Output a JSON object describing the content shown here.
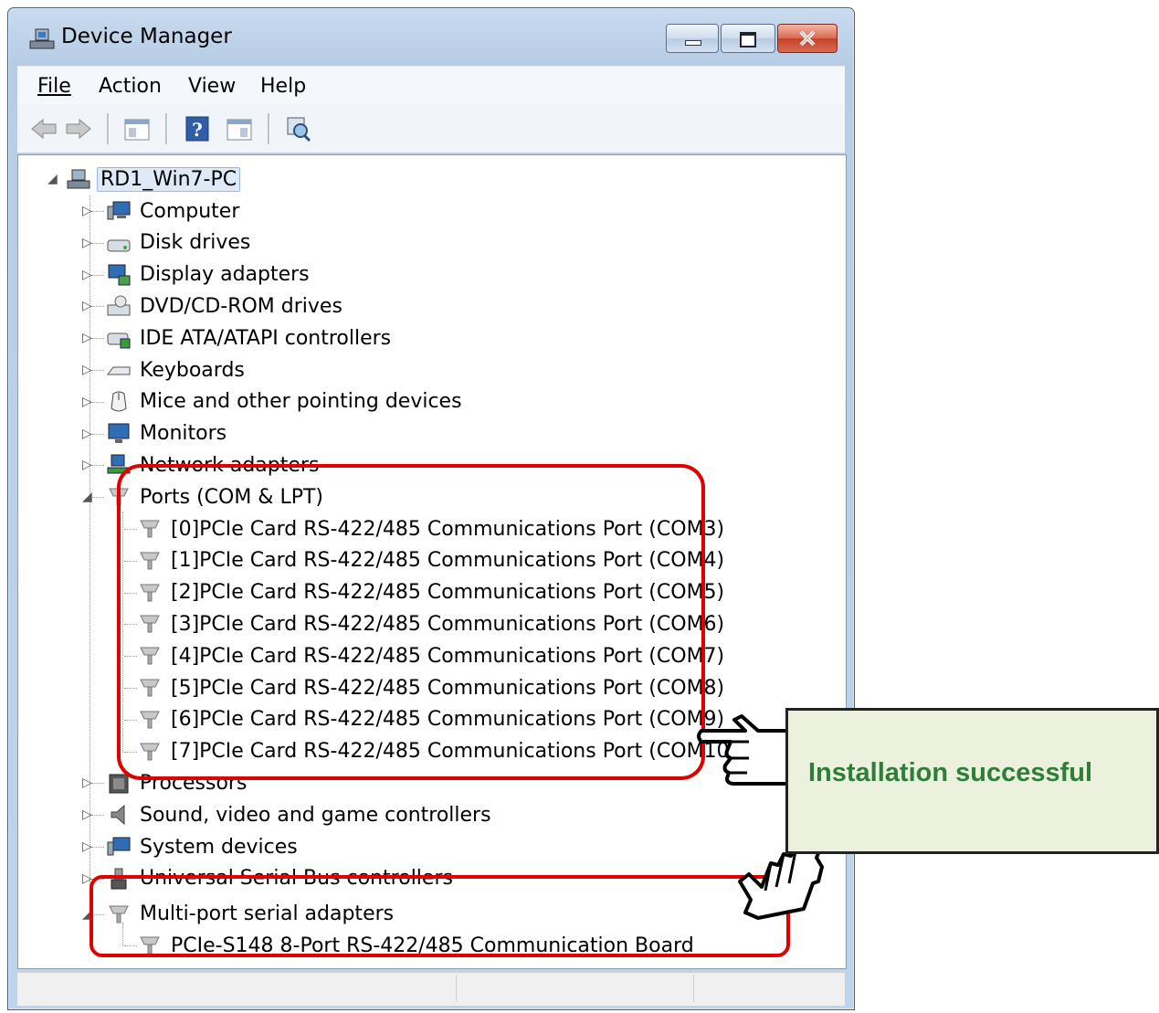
{
  "window": {
    "title": "Device Manager",
    "buttons": {
      "minimize": "minimize",
      "maximize": "maximize",
      "close": "close"
    }
  },
  "menu": [
    "File",
    "Action",
    "View",
    "Help"
  ],
  "toolbar": [
    "back-icon",
    "forward-icon",
    "properties-pane-icon",
    "help-icon",
    "show-hidden-icon",
    "scan-hardware-icon"
  ],
  "tree": {
    "root": "RD1_Win7-PC",
    "categories": [
      {
        "label": "Computer",
        "icon": "computer-icon",
        "expanded": false
      },
      {
        "label": "Disk drives",
        "icon": "disk-drive-icon",
        "expanded": false
      },
      {
        "label": "Display adapters",
        "icon": "display-adapter-icon",
        "expanded": false
      },
      {
        "label": "DVD/CD-ROM drives",
        "icon": "dvd-drive-icon",
        "expanded": false
      },
      {
        "label": "IDE ATA/ATAPI controllers",
        "icon": "ide-controller-icon",
        "expanded": false
      },
      {
        "label": "Keyboards",
        "icon": "keyboard-icon",
        "expanded": false
      },
      {
        "label": "Mice and other pointing devices",
        "icon": "mouse-icon",
        "expanded": false
      },
      {
        "label": "Monitors",
        "icon": "monitor-icon",
        "expanded": false
      },
      {
        "label": "Network adapters",
        "icon": "network-adapter-icon",
        "expanded": false
      },
      {
        "label": "Ports (COM & LPT)",
        "icon": "port-icon",
        "expanded": true
      },
      {
        "label": "Processors",
        "icon": "processor-icon",
        "expanded": false
      },
      {
        "label": "Sound, video and game controllers",
        "icon": "sound-icon",
        "expanded": false
      },
      {
        "label": "System devices",
        "icon": "system-device-icon",
        "expanded": false
      },
      {
        "label": "Universal Serial Bus controllers",
        "icon": "usb-icon",
        "expanded": false
      },
      {
        "label": "Multi-port serial adapters",
        "icon": "port-icon",
        "expanded": true
      }
    ],
    "ports": [
      "[0]PCIe Card RS-422/485 Communications Port (COM3)",
      "[1]PCIe Card RS-422/485 Communications Port (COM4)",
      "[2]PCIe Card RS-422/485 Communications Port (COM5)",
      "[3]PCIe Card RS-422/485 Communications Port (COM6)",
      "[4]PCIe Card RS-422/485 Communications Port (COM7)",
      "[5]PCIe Card RS-422/485 Communications Port (COM8)",
      "[6]PCIe Card RS-422/485 Communications Port (COM9)",
      "[7]PCIe Card RS-422/485 Communications Port (COM10)"
    ],
    "multiport": [
      "PCIe-S148 8-Port RS-422/485 Communication Board"
    ]
  },
  "annotation": {
    "callout": "Installation successful",
    "highlight_color": "#e00000",
    "callout_bg": "#ebf1dd",
    "callout_text_color": "#2e7d38"
  }
}
